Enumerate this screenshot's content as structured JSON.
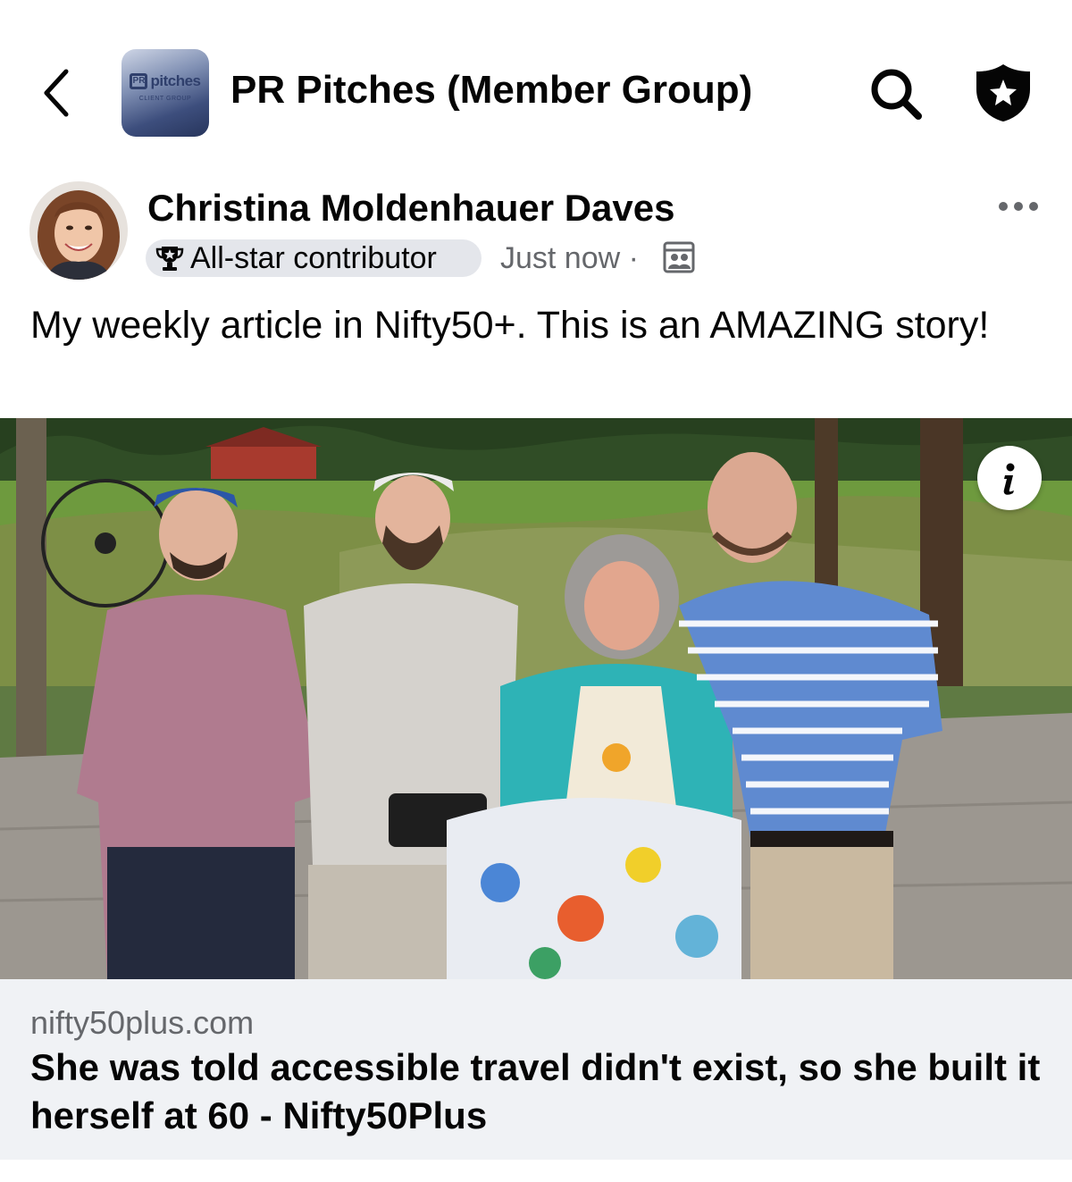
{
  "header": {
    "group_title": "PR Pitches (Member Group)",
    "group_logo": {
      "word": "pitches",
      "mark": "PR",
      "subtitle": "CLIENT GROUP"
    },
    "icons": [
      "chevron-left-icon",
      "search-icon",
      "shield-star-icon"
    ]
  },
  "post": {
    "author": "Christina Moldenhauer Daves",
    "badge": "All-star contributor",
    "badge_icon": "trophy-icon",
    "time": "Just now ·",
    "audience_icon": "members-group-icon",
    "more_icon": "more-dots-icon",
    "text": "My weekly article in Nifty50+. This is an AMAZING story!"
  },
  "photo": {
    "info_icon": "info-icon"
  },
  "link_preview": {
    "domain": "nifty50plus.com",
    "title": "She was told accessible travel didn't exist, so she built it herself at 60 - Nifty50Plus"
  },
  "colors": {
    "text_primary": "#050505",
    "text_secondary": "#65676b",
    "badge_bg": "#e4e6eb",
    "link_bg": "#f0f2f5"
  }
}
